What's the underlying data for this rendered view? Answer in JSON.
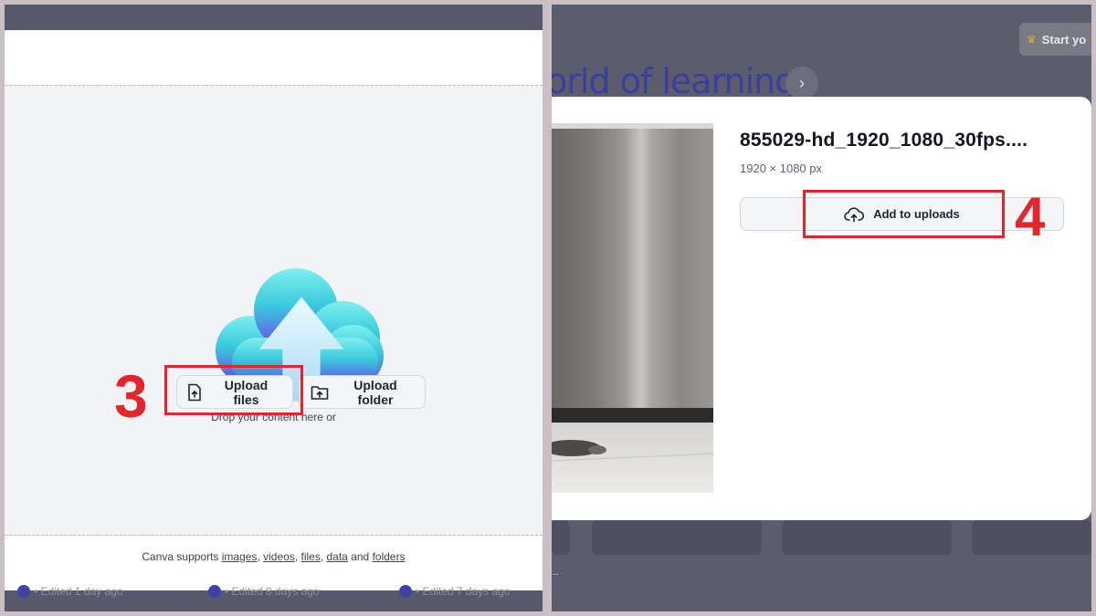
{
  "left": {
    "drop_hint": "Drop your content here or",
    "upload_files_label": "Upload files",
    "upload_folder_label": "Upload folder",
    "step_label": "3",
    "supports": {
      "prefix": "Canva supports",
      "images": "images",
      "videos": "videos",
      "files": "files",
      "data": "data",
      "and": "and",
      "folders": "folders"
    },
    "footer_items": [
      "• Edited 1 day ago",
      "• Edited 8 days ago",
      "• Edited 7 days ago"
    ]
  },
  "right": {
    "background": {
      "heading": "orld of learning",
      "start_button_label": "Start yo",
      "next_icon": "›",
      "dots": "..."
    },
    "file_name": "855029-hd_1920_1080_30fps....",
    "file_dimensions": "1920 × 1080 px",
    "add_to_uploads_label": "Add to uploads",
    "step_label": "4"
  },
  "colors": {
    "annotation_red": "#e3262b",
    "brand_purple": "#3a3f9e",
    "cloud_cyan": "#3fd0da",
    "cloud_purple": "#6b4fe0"
  },
  "icons": {
    "upload_files": "file-upload-icon",
    "upload_folder": "folder-upload-icon",
    "add_to_uploads": "cloud-upload-icon",
    "hero": "cloud-upload-illustration"
  }
}
